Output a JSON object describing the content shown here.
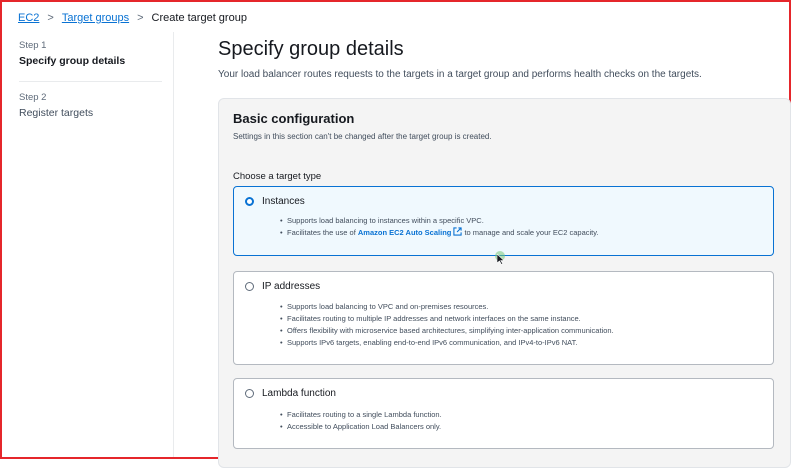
{
  "breadcrumb": {
    "items": [
      "EC2",
      "Target groups",
      "Create target group"
    ],
    "separator": ">"
  },
  "steps": [
    {
      "num": "Step 1",
      "title": "Specify group details"
    },
    {
      "num": "Step 2",
      "title": "Register targets"
    }
  ],
  "header": {
    "title": "Specify group details",
    "description": "Your load balancer routes requests to the targets in a target group and performs health checks on the targets."
  },
  "basic": {
    "title": "Basic configuration",
    "subtitle": "Settings in this section can't be changed after the target group is created."
  },
  "target_type": {
    "label": "Choose a target type",
    "options": [
      {
        "label": "Instances",
        "bullet1": "Supports load balancing to instances within a specific VPC.",
        "bullet2_pre": "Facilitates the use of ",
        "bullet2_link": "Amazon EC2 Auto Scaling",
        "bullet2_post": " to manage and scale your EC2 capacity."
      },
      {
        "label": "IP addresses",
        "bullets": [
          "Supports load balancing to VPC and on-premises resources.",
          "Facilitates routing to multiple IP addresses and network interfaces on the same instance.",
          "Offers flexibility with microservice based architectures, simplifying inter-application communication.",
          "Supports IPv6 targets, enabling end-to-end IPv6 communication, and IPv4-to-IPv6 NAT."
        ]
      },
      {
        "label": "Lambda function",
        "bullets": [
          "Facilitates routing to a single Lambda function.",
          "Accessible to Application Load Balancers only."
        ]
      }
    ]
  },
  "colors": {
    "accent": "#0972d3",
    "frame": "#e5262b"
  }
}
